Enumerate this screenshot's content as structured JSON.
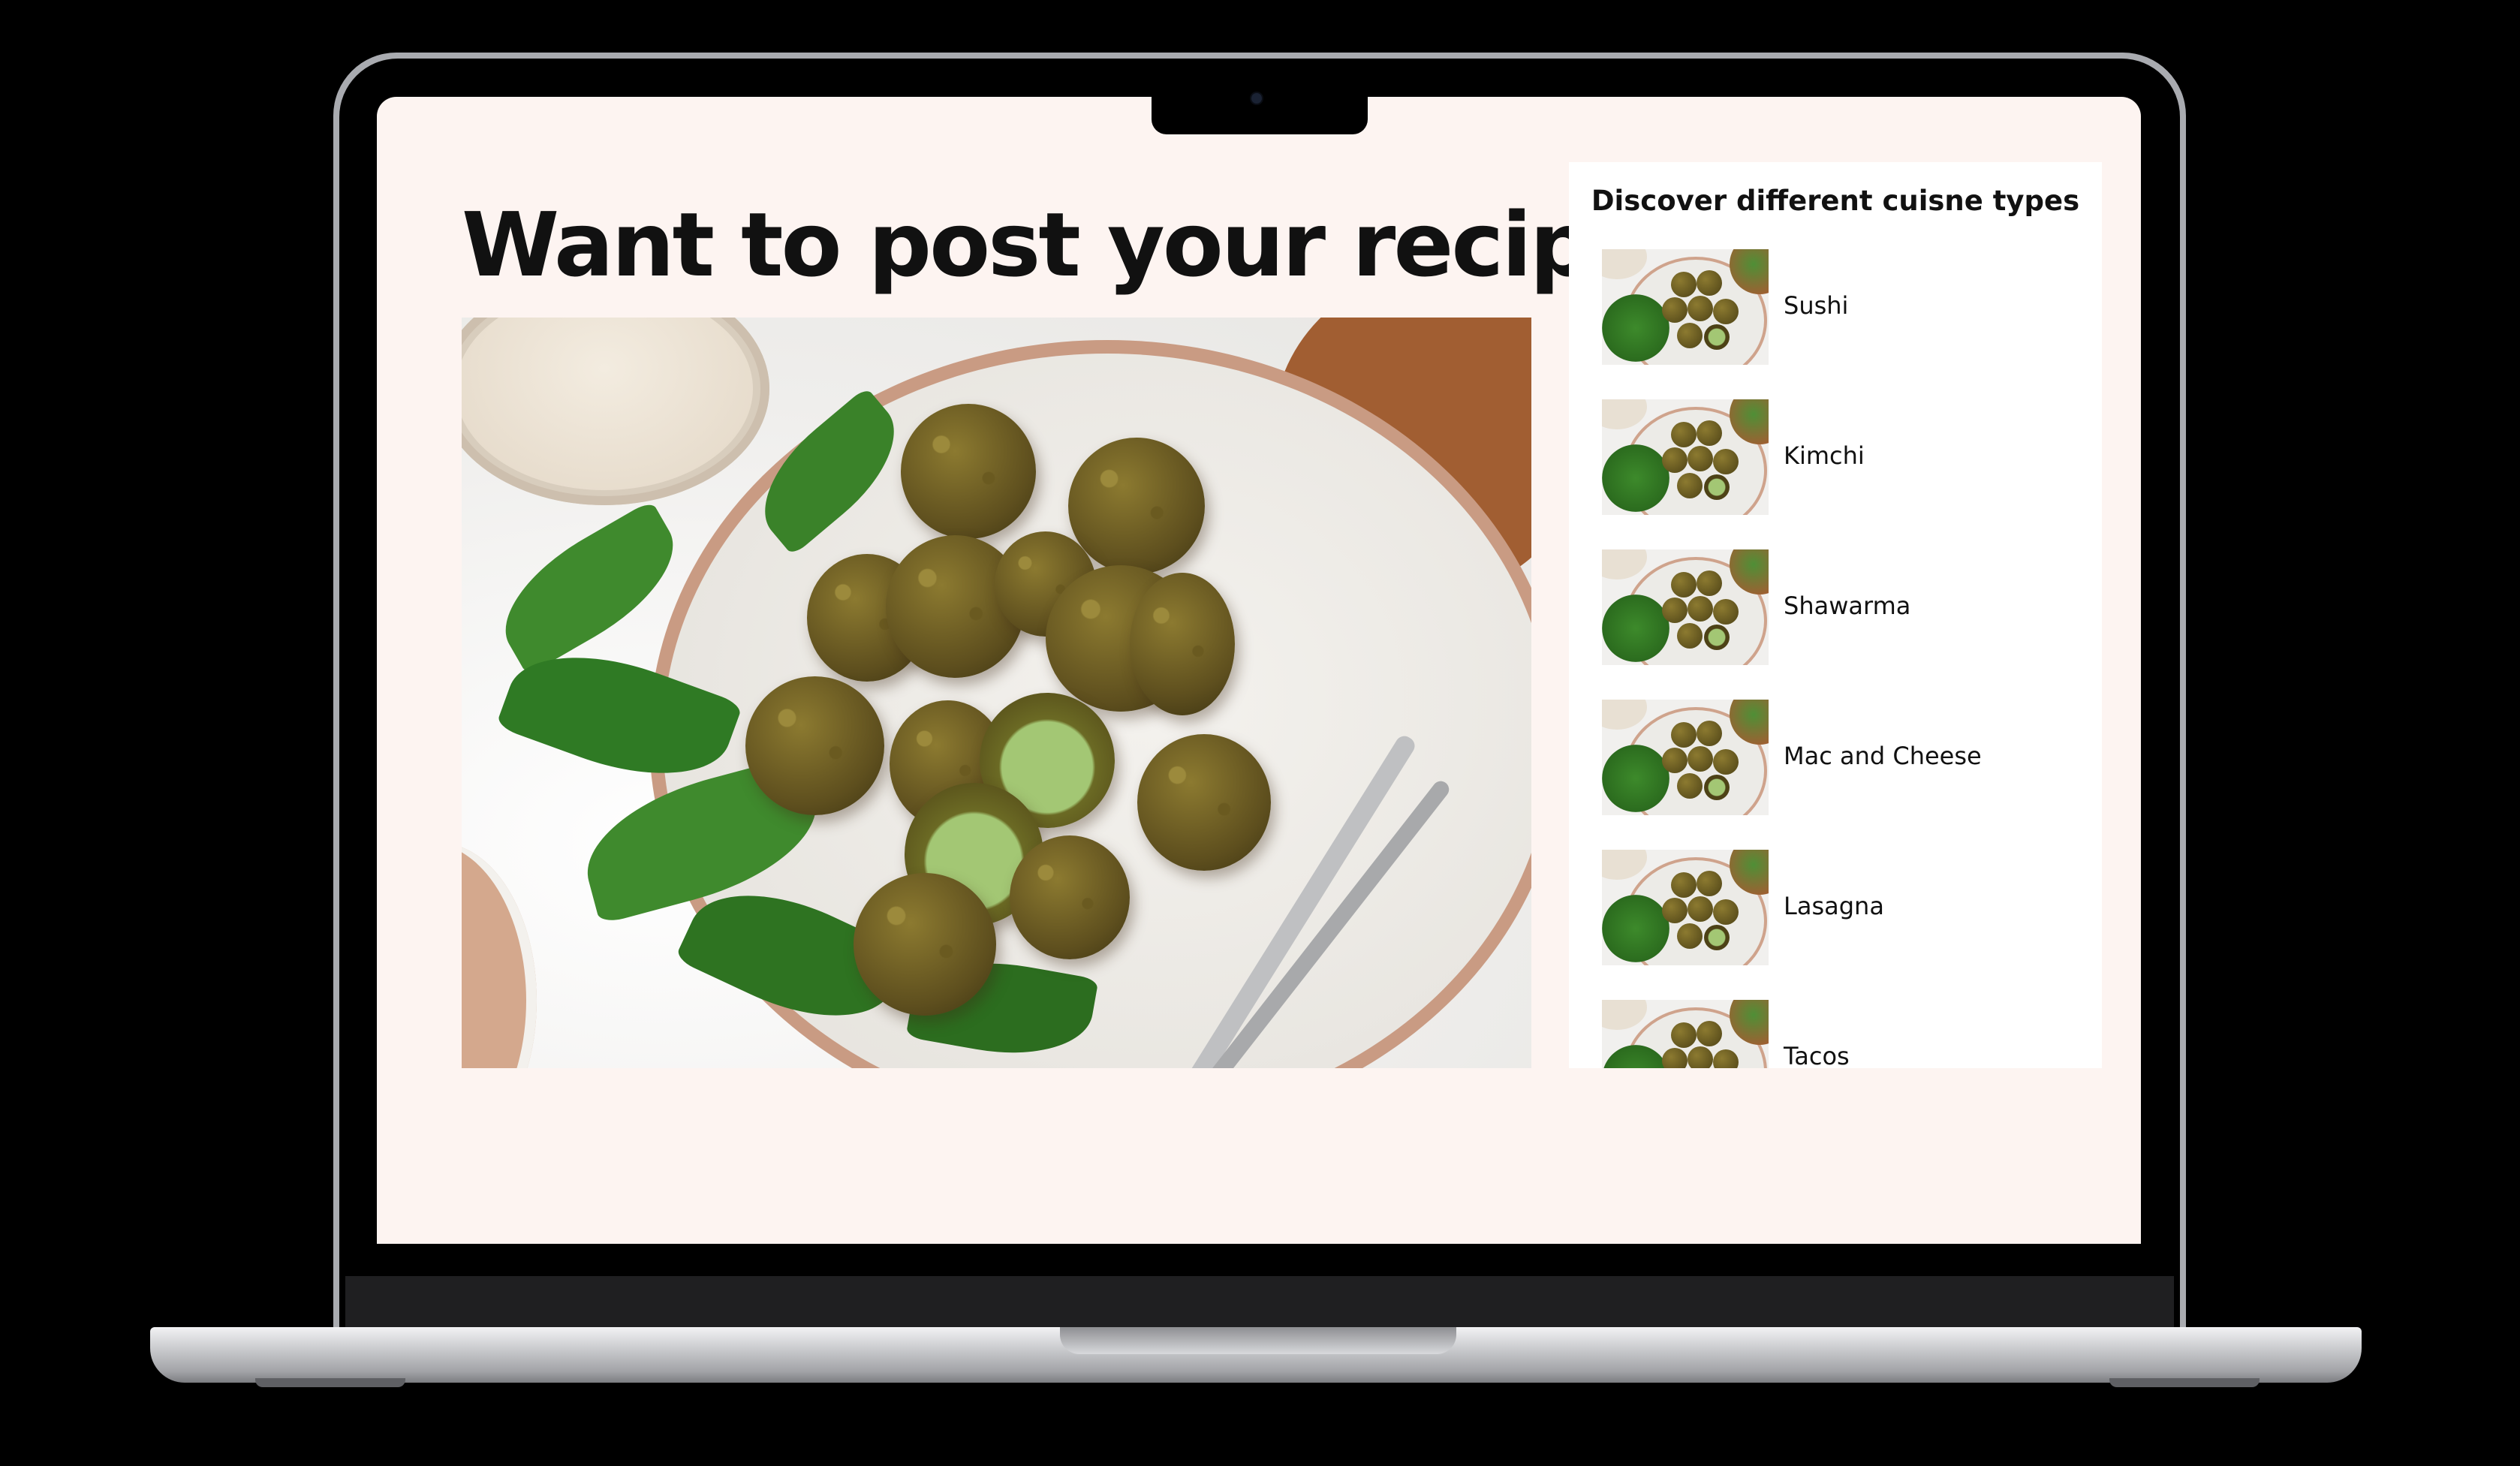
{
  "page": {
    "title": "Want to post your recipe?",
    "hero_image_alt": "falafel-plate-photo"
  },
  "sidebar": {
    "title": "Discover different cuisne types",
    "items": [
      {
        "label": "Sushi"
      },
      {
        "label": "Kimchi"
      },
      {
        "label": "Shawarma"
      },
      {
        "label": "Mac and Cheese"
      },
      {
        "label": "Lasagna"
      },
      {
        "label": "Tacos"
      }
    ]
  },
  "colors": {
    "page_background": "#fdf4f1",
    "panel_background": "#ffffff",
    "text": "#111111"
  }
}
